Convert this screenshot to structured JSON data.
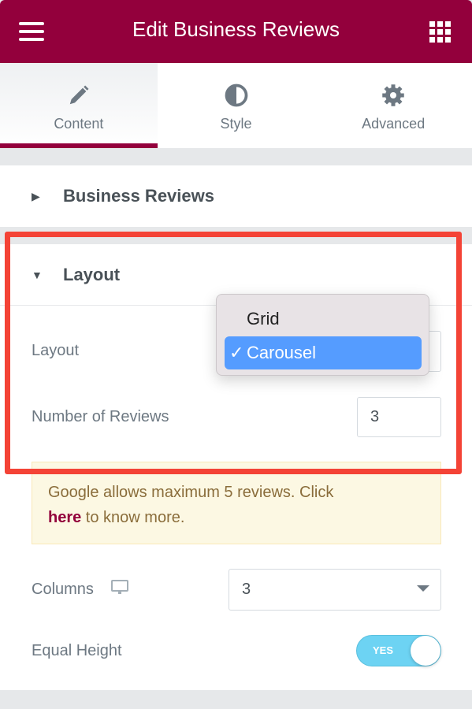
{
  "header": {
    "title": "Edit Business Reviews",
    "menu_icon": "hamburger-icon",
    "apps_icon": "grid-icon"
  },
  "tabs": [
    {
      "label": "Content",
      "icon": "pencil-icon",
      "active": true
    },
    {
      "label": "Style",
      "icon": "half-circle-icon",
      "active": false
    },
    {
      "label": "Advanced",
      "icon": "gear-icon",
      "active": false
    }
  ],
  "sections": {
    "business_reviews": {
      "title": "Business Reviews",
      "expanded": false
    },
    "layout": {
      "title": "Layout",
      "expanded": true
    }
  },
  "fields": {
    "layout": {
      "label": "Layout",
      "value": "Carousel",
      "options": [
        "Grid",
        "Carousel"
      ]
    },
    "num_reviews": {
      "label": "Number of Reviews",
      "value": "3"
    },
    "notice": {
      "text_before": "Google allows maximum 5 reviews. Click ",
      "link": "here",
      "text_after": " to know more."
    },
    "columns": {
      "label": "Columns",
      "value": "3",
      "device_icon": "desktop-icon"
    },
    "equal_height": {
      "label": "Equal Height",
      "toggle_label": "YES",
      "on": true
    }
  },
  "colors": {
    "brand": "#93003c",
    "highlight": "#f44336",
    "selection": "#559cff",
    "toggle": "#6dd3f3"
  }
}
